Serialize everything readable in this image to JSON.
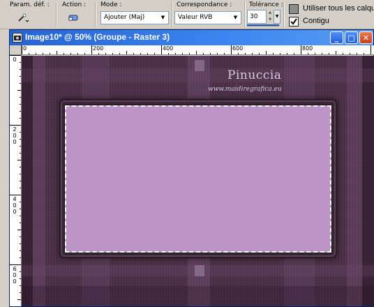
{
  "toolbar": {
    "presets_label": "Param. déf. :",
    "action_label": "Action :",
    "mode_label": "Mode :",
    "mode_value": "Ajouter (Maj)",
    "match_label": "Correspondance :",
    "match_value": "Valeur RVB",
    "tolerance_label": "Tolérance :",
    "tolerance_value": "30",
    "use_all_layers_label": "Utiliser tous les calque",
    "use_all_layers_checked": false,
    "contiguous_label": "Contigu",
    "contiguous_checked": true,
    "icons": {
      "presets": "magic-wand-icon",
      "action": "eraser-icon"
    }
  },
  "window": {
    "title": "Image10* @  50% (Groupe - Raster 3)",
    "buttons": [
      "_",
      "□",
      "✕"
    ],
    "ruler_h": [
      "0",
      "200",
      "400",
      "600",
      "800"
    ],
    "ruler_v": [
      "0",
      "200",
      "400",
      "600"
    ]
  },
  "canvas": {
    "watermark_name": "Pinuccia",
    "watermark_site": "www.maidiregrafica.eu",
    "colors": {
      "background": "#4c3048",
      "frame": "#3a2537",
      "fill": "#bd94c6",
      "accent": "#2663d2"
    }
  }
}
